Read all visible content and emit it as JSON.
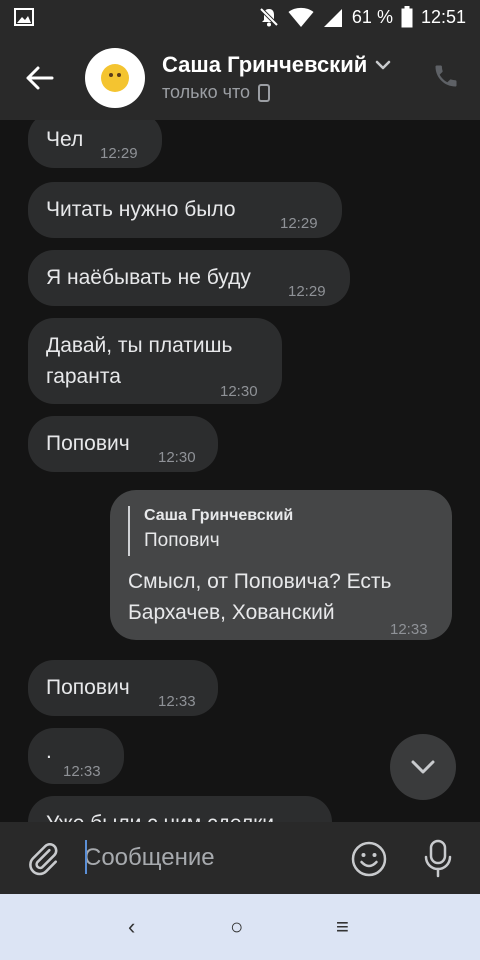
{
  "status_bar": {
    "battery_percent": "61 %",
    "time": "12:51"
  },
  "header": {
    "contact_name": "Саша Гринчевский",
    "contact_status": "только что"
  },
  "messages": [
    {
      "direction": "in",
      "text": "Чел",
      "time": "12:29"
    },
    {
      "direction": "in",
      "text": "Читать нужно было",
      "time": "12:29"
    },
    {
      "direction": "in",
      "text": "Я наёбывать не буду",
      "time": "12:29"
    },
    {
      "direction": "in",
      "text": "Давай, ты платишь\nгаранта",
      "time": "12:30"
    },
    {
      "direction": "in",
      "text": "Попович",
      "time": "12:30"
    },
    {
      "direction": "out",
      "reply_author": "Саша Гринчевский",
      "reply_text": "Попович",
      "text": "Смысл, от Поповича? Есть\nБархачев, Хованский",
      "time": "12:33"
    },
    {
      "direction": "in",
      "text": "Попович",
      "time": "12:33"
    },
    {
      "direction": "in",
      "text": ".",
      "time": "12:33"
    },
    {
      "direction": "in",
      "text": "Уже были с ним сделки",
      "time": ""
    }
  ],
  "composer": {
    "placeholder": "Сообщение"
  },
  "navbar": {
    "back": "‹",
    "home": "○",
    "recents": "≡"
  },
  "colors": {
    "background": "#141414",
    "bar": "#292929",
    "incoming_bubble": "#2c2d2e",
    "outgoing_bubble": "#454647",
    "navbar": "#dce4f4"
  }
}
